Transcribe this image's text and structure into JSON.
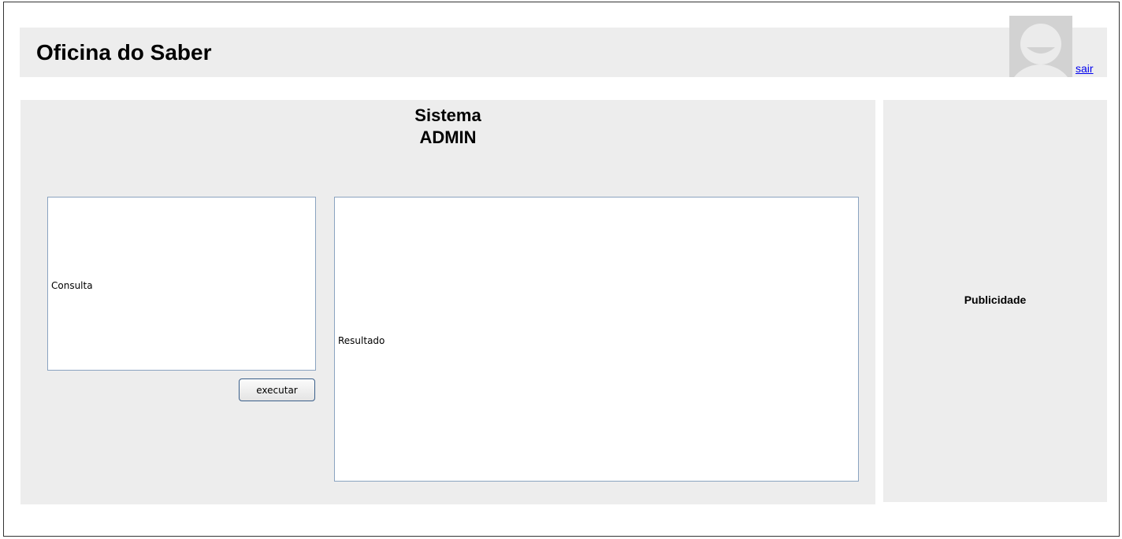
{
  "header": {
    "title": "Oficina do Saber",
    "avatar_icon": "user-avatar-icon",
    "logout_label": "sair"
  },
  "main": {
    "title_line1": "Sistema",
    "title_line2": "ADMIN",
    "query_label": "Consulta",
    "execute_label": "executar",
    "result_label": "Resultado"
  },
  "sidebar": {
    "ad_label": "Publicidade"
  },
  "colors": {
    "panel_background": "#ededed",
    "box_border": "#8aa3c0",
    "button_border": "#3a5f8a",
    "link": "#0000ee"
  }
}
